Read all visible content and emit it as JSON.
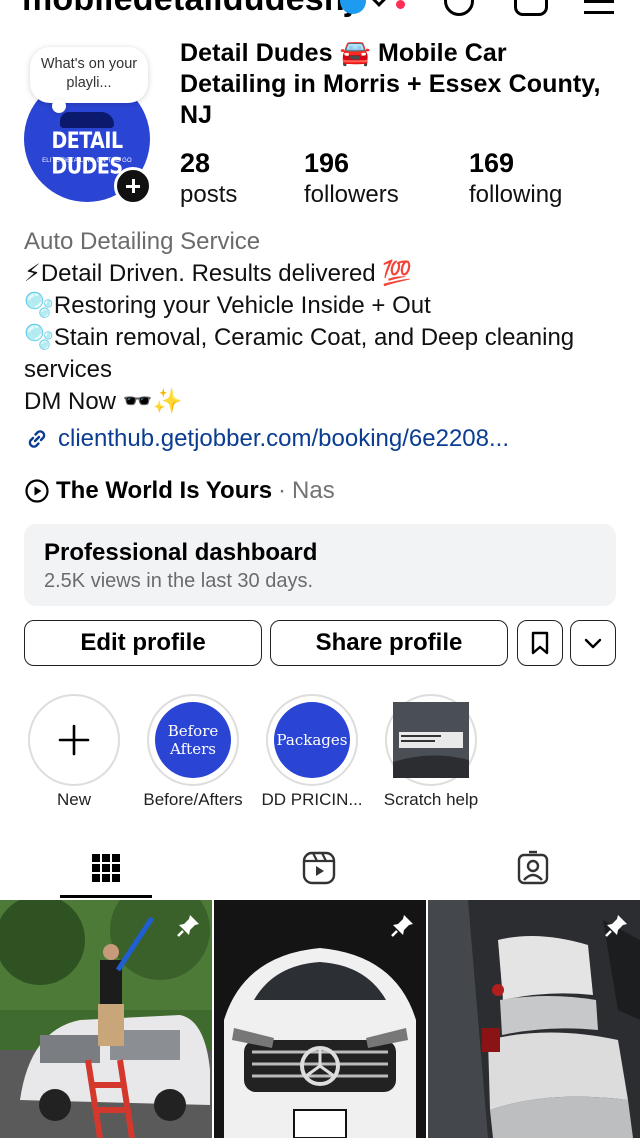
{
  "header": {
    "username": "mobiledetaildudesnj"
  },
  "profile": {
    "note": "What's on your playli...",
    "avatar_logo_text": "DETAIL DUDES",
    "avatar_tagline": "ELITE DETAILING ON THE GO",
    "display_name": "Detail Dudes 🚘 Mobile Car Detailing in Morris + Essex County, NJ",
    "stats": [
      {
        "num": "28",
        "label": "posts"
      },
      {
        "num": "196",
        "label": "followers"
      },
      {
        "num": "169",
        "label": "following"
      }
    ]
  },
  "bio": {
    "category": "Auto Detailing Service",
    "lines": [
      "⚡Detail Driven. Results delivered 💯",
      "🫧Restoring your Vehicle Inside + Out",
      "🫧Stain removal, Ceramic Coat, and Deep cleaning services",
      "DM Now 🕶️✨"
    ],
    "link": "clienthub.getjobber.com/booking/6e2208...",
    "music_song": "The World Is Yours",
    "music_sep": "·",
    "music_artist": "Nas"
  },
  "dashboard": {
    "title": "Professional dashboard",
    "subtitle": "2.5K views in the last 30 days."
  },
  "buttons": {
    "edit": "Edit profile",
    "share": "Share profile"
  },
  "highlights": [
    {
      "label": "New",
      "cover": ""
    },
    {
      "label": "Before/Afters",
      "cover": "Before Afters"
    },
    {
      "label": "DD PRICIN...",
      "cover": "Packages"
    },
    {
      "label": "Scratch help",
      "cover": ""
    }
  ],
  "tabs": [
    "grid-icon",
    "reels-icon",
    "tagged-icon"
  ],
  "colors": {
    "brand_blue": "#2a44d4",
    "link": "#0a3d91",
    "muted": "#6b6b6b",
    "dashboard_bg": "#f2f3f5"
  }
}
